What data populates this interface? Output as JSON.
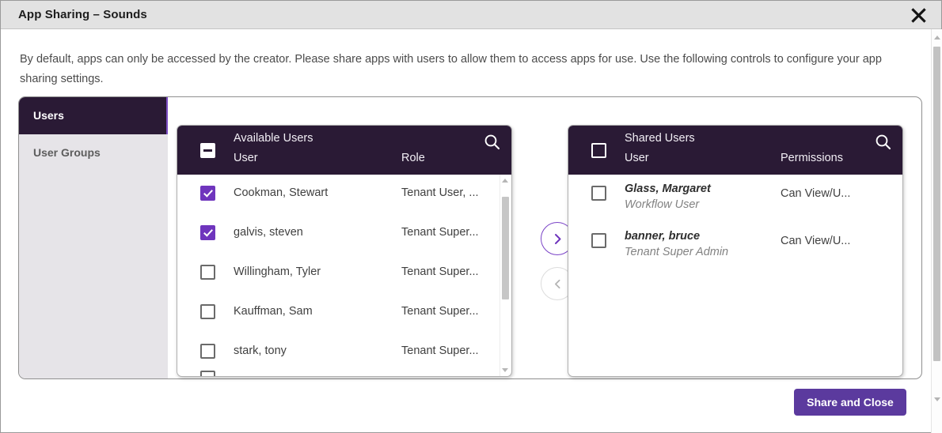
{
  "titlebar": {
    "title": "App Sharing – Sounds",
    "close_icon": "close-icon"
  },
  "intro": {
    "text": "By default, apps can only be accessed by the creator. Please share apps with users to allow them to access apps for use. Use the following controls to configure your app sharing settings."
  },
  "tabs": [
    {
      "label": "Users",
      "active": true
    },
    {
      "label": "User Groups",
      "active": false
    }
  ],
  "available_panel": {
    "title": "Available Users",
    "col_user": "User",
    "col_right": "Role",
    "search_icon": "search-icon",
    "header_checkbox_state": "indeterminate",
    "rows": [
      {
        "name": "Cookman, Stewart",
        "right": "Tenant User, ...",
        "checked": true
      },
      {
        "name": "galvis, steven",
        "right": "Tenant Super...",
        "checked": true
      },
      {
        "name": "Willingham, Tyler",
        "right": "Tenant Super...",
        "checked": false
      },
      {
        "name": "Kauffman, Sam",
        "right": "Tenant Super...",
        "checked": false
      },
      {
        "name": "stark, tony",
        "right": "Tenant Super...",
        "checked": false
      }
    ]
  },
  "shared_panel": {
    "title": "Shared Users",
    "col_user": "User",
    "col_right": "Permissions",
    "search_icon": "search-icon",
    "header_checkbox_state": "unchecked",
    "rows": [
      {
        "name": "Glass, Margaret",
        "sub": "Workflow User",
        "right": "Can View/U...",
        "checked": false
      },
      {
        "name": "banner, bruce",
        "sub": "Tenant Super Admin",
        "right": "Can View/U...",
        "checked": false
      }
    ]
  },
  "transfer": {
    "forward_icon": "chevron-right-icon",
    "backward_icon": "chevron-left-icon"
  },
  "footer": {
    "share_label": "Share and Close"
  },
  "colors": {
    "header_dark": "#2a1a35",
    "accent_purple": "#6f35bd",
    "button_purple": "#5b3a9e",
    "titlebar_gray": "#e2e2e2",
    "tab_inactive_bg": "#e6e4e8"
  }
}
